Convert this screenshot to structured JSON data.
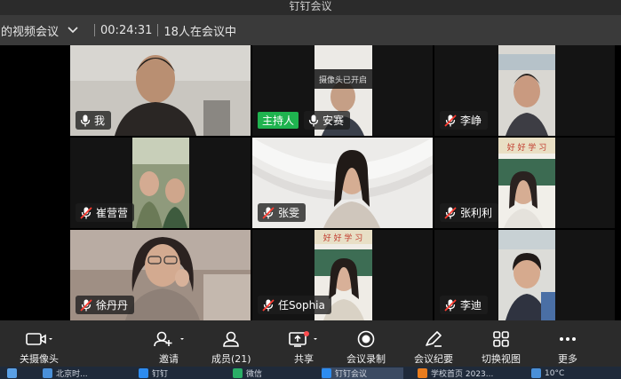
{
  "window": {
    "title": "钉钉会议"
  },
  "info_bar": {
    "meeting_name": "的视频会议",
    "duration": "00:24:31",
    "attendee_count_text": "18人在会议中"
  },
  "camera_toast": "摄像头已开启",
  "participants": [
    {
      "name": "我",
      "mic": "on",
      "host": false
    },
    {
      "name": "安赛",
      "mic": "on",
      "host": true,
      "host_label": "主持人"
    },
    {
      "name": "李峥",
      "mic": "muted",
      "host": false
    },
    {
      "name": "崔营营",
      "mic": "muted",
      "host": false
    },
    {
      "name": "张雯",
      "mic": "muted",
      "host": false
    },
    {
      "name": "张利利",
      "mic": "muted",
      "host": false
    },
    {
      "name": "徐丹丹",
      "mic": "muted",
      "host": false
    },
    {
      "name": "任Sophia",
      "mic": "muted",
      "host": false
    },
    {
      "name": "李迪",
      "mic": "muted",
      "host": false
    }
  ],
  "toolbar": {
    "camera": "关摄像头",
    "invite": "邀请",
    "members": "成员(21)",
    "share": "共享",
    "record": "会议录制",
    "minutes": "会议纪要",
    "switch_view": "切换视图",
    "more": "更多"
  },
  "taskbar": {
    "items": [
      "北京时...",
      "钉钉",
      "微信",
      "钉钉会议",
      "学校首页 2023..."
    ],
    "temperature": "10°C"
  },
  "colors": {
    "host_green": "#1fb34f",
    "mute_red": "#ff3b30",
    "toolbar_bg": "#2b2b2b",
    "share_dot": "#ff4d4f"
  }
}
